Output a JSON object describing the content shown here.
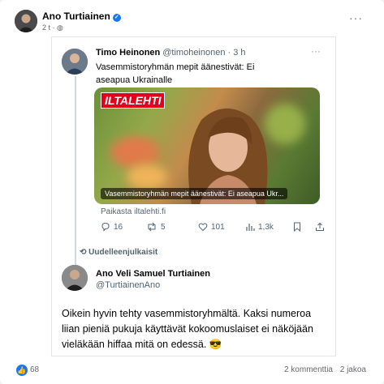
{
  "fb_post": {
    "author": "Ano Turtiainen",
    "meta": "2 t · ",
    "more": "···",
    "reactions_count": "68",
    "comments": "2 kommenttia",
    "shares": "2 jakoa"
  },
  "tweet": {
    "author_name": "Timo Heinonen",
    "author_handle": "@timoheinonen · 3 h",
    "more": "···",
    "text": "Vasemmistoryhmän mepit äänestivät: Ei aseapua Ukrainalle",
    "media_logo": "ILTALEHTI",
    "media_caption": "Vasemmistoryhmän mepit äänestivät: Ei aseapua Ukr...",
    "link_source": "Paikasta iltalehti.fi",
    "actions": {
      "replies": "16",
      "retweets": "5",
      "likes": "101",
      "views": "1,3k"
    }
  },
  "retweet_label": "Uudelleenjulkaisit",
  "quote": {
    "author_name": "Ano Veli Samuel Turtiainen",
    "author_handle": "@TurtiainenAno",
    "text": "Oikein hyvin tehty vasemmistoryhmältä. Kaksi numeroa liian pieniä pukuja käyttävät kokoomuslaiset ei näköjään vieläkään hiffaa mitä on edessä. 😎"
  },
  "colors": {
    "brand": "#1877f2",
    "iltalehti_red": "#e3001b",
    "muted": "#536471"
  }
}
